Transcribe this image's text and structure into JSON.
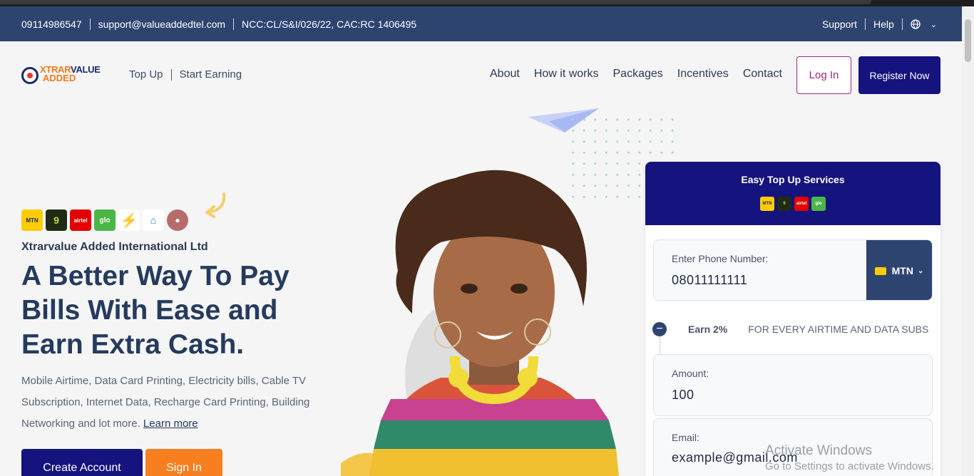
{
  "topbar": {
    "phone": "09114986547",
    "email": "support@valueaddedtel.com",
    "license": "NCC:CL/S&I/026/22, CAC:RC 1406495",
    "support": "Support",
    "help": "Help"
  },
  "nav": {
    "logo_line1a": "XTRAR",
    "logo_line1b": "VALUE",
    "logo_line2": "ADDED",
    "top_up": "Top Up",
    "start_earning": "Start Earning",
    "about": "About",
    "how_it_works": "How it works",
    "packages": "Packages",
    "incentives": "Incentives",
    "contact": "Contact",
    "login": "Log In",
    "register": "Register Now"
  },
  "hero": {
    "company": "Xtrarvalue Added International Ltd",
    "headline": "A Better Way To Pay Bills With Ease and Earn Extra Cash.",
    "description": "Mobile Airtime, Data Card Printing, Electricity bills, Cable TV Subscription, Internet Data, Recharge Card Printing, Building Networking and lot more.",
    "learn_more": "Learn more",
    "create_account": "Create Account",
    "sign_in": "Sign In",
    "networks": [
      "MTN",
      "9mobile",
      "airtel",
      "glo"
    ]
  },
  "card": {
    "title": "Easy Top Up Services",
    "phone_label": "Enter Phone Number:",
    "phone_value": "08011111111",
    "network": "MTN",
    "earn": "Earn 2%",
    "earn_note": "FOR EVERY AIRTIME AND DATA SUBS",
    "amount_label": "Amount:",
    "amount_value": "100",
    "email_label": "Email:",
    "email_value": "example@gmail.com"
  },
  "watermark": {
    "line1": "Activate Windows",
    "line2": "Go to Settings to activate Windows."
  }
}
